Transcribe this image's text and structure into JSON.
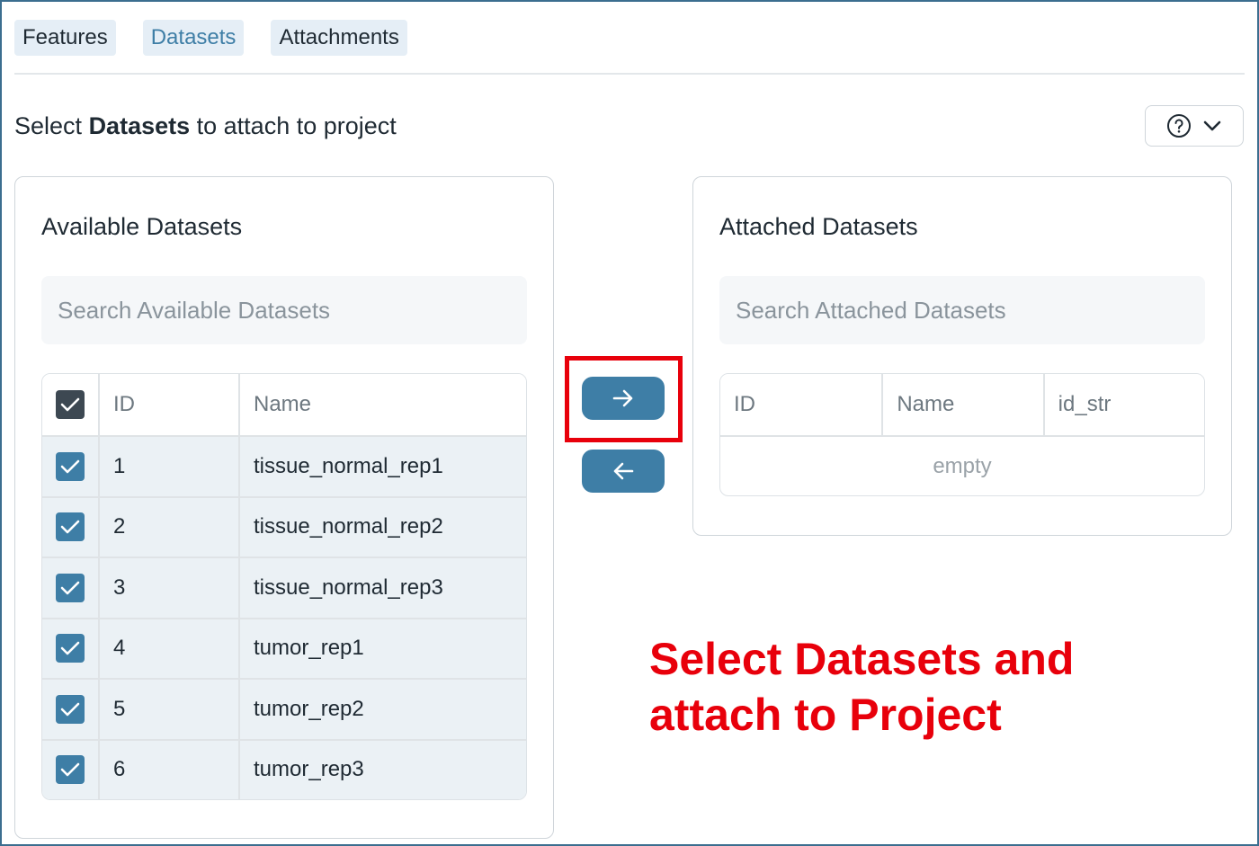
{
  "tabs": [
    {
      "label": "Features"
    },
    {
      "label": "Datasets",
      "active": true
    },
    {
      "label": "Attachments"
    }
  ],
  "heading": {
    "prefix": "Select",
    "bold": "Datasets",
    "suffix": "to attach to project"
  },
  "help": {
    "icon": "help-circle-icon",
    "chevron": "chevron-down-icon"
  },
  "available": {
    "title": "Available Datasets",
    "search_placeholder": "Search Available Datasets",
    "columns": [
      "ID",
      "Name"
    ],
    "rows": [
      {
        "id": "1",
        "name": "tissue_normal_rep1",
        "checked": true
      },
      {
        "id": "2",
        "name": "tissue_normal_rep2",
        "checked": true
      },
      {
        "id": "3",
        "name": "tissue_normal_rep3",
        "checked": true
      },
      {
        "id": "4",
        "name": "tumor_rep1",
        "checked": true
      },
      {
        "id": "5",
        "name": "tumor_rep2",
        "checked": true
      },
      {
        "id": "6",
        "name": "tumor_rep3",
        "checked": true
      }
    ]
  },
  "attached": {
    "title": "Attached Datasets",
    "search_placeholder": "Search Attached Datasets",
    "columns": [
      "ID",
      "Name",
      "id_str"
    ],
    "empty_text": "empty"
  },
  "annotation": {
    "line1": "Select Datasets and",
    "line2": "attach to Project"
  },
  "colors": {
    "accent": "#3e7ea6",
    "annotation": "#e8000b",
    "header_check": "#3d4852"
  }
}
